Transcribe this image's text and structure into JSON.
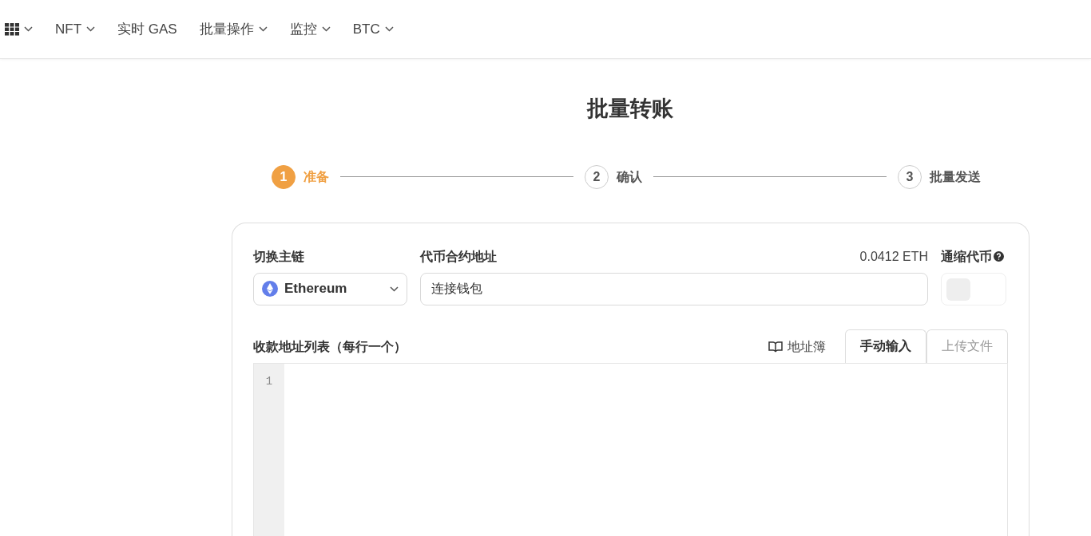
{
  "nav": {
    "items": [
      {
        "label": "NFT",
        "dropdown": true
      },
      {
        "label": "实时 GAS",
        "dropdown": false
      },
      {
        "label": "批量操作",
        "dropdown": true
      },
      {
        "label": "监控",
        "dropdown": true
      },
      {
        "label": "BTC",
        "dropdown": true
      }
    ]
  },
  "title": "批量转账",
  "steps": [
    {
      "number": "1",
      "label": "准备",
      "selected": true
    },
    {
      "number": "2",
      "label": "确认",
      "selected": false
    },
    {
      "number": "3",
      "label": "批量发送",
      "selected": false
    }
  ],
  "form": {
    "chain_label": "切换主链",
    "chain_value": "Ethereum",
    "contract_label": "代币合约地址",
    "balance": "0.0412 ETH",
    "contract_value": "连接钱包",
    "deflation_label": "通缩代币",
    "deflation_on": false
  },
  "recipients": {
    "label": "收款地址列表（每行一个）",
    "address_book": "地址簿",
    "tabs": [
      {
        "label": "手动输入",
        "selected": true
      },
      {
        "label": "上传文件",
        "selected": false
      }
    ],
    "line_numbers": [
      "1"
    ]
  }
}
